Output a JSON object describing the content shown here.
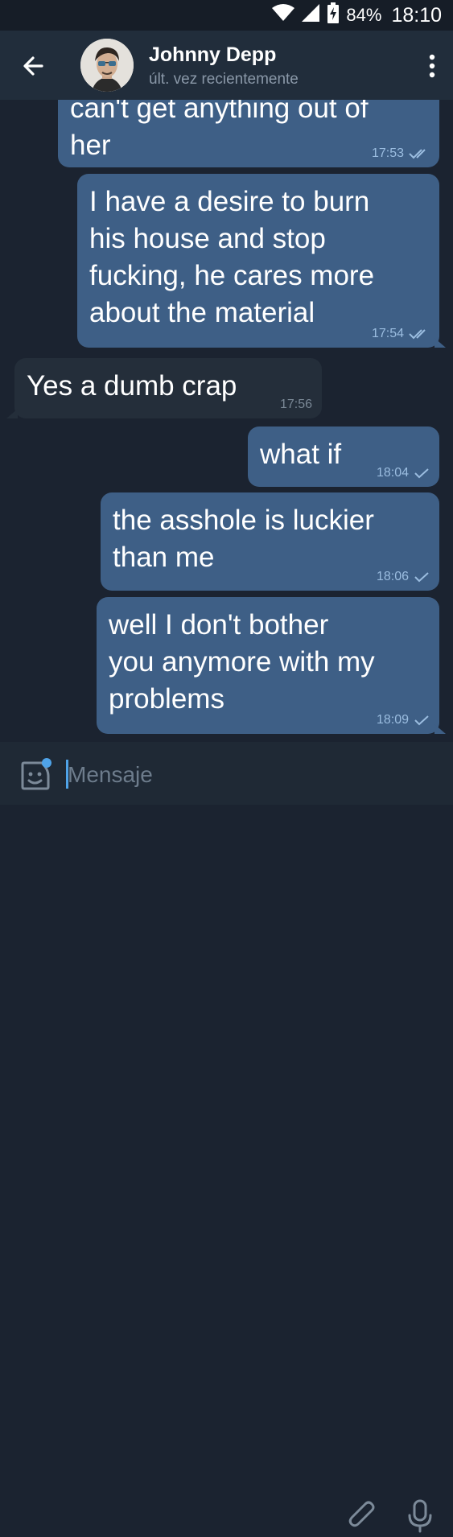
{
  "status_bar": {
    "battery": "84%",
    "time": "18:10"
  },
  "header": {
    "contact_name": "Johnny Depp",
    "contact_status": "últ. vez recientemente"
  },
  "messages": [
    {
      "direction": "out",
      "text": "can't get anything out of\nher",
      "time": "17:53",
      "status": "read"
    },
    {
      "direction": "out",
      "text": "I have a desire to burn\nhis house and stop\nfucking, he cares more\nabout the material",
      "time": "17:54",
      "status": "read"
    },
    {
      "direction": "in",
      "text": "Yes a dumb crap",
      "time": "17:56"
    },
    {
      "direction": "out",
      "text": "what if",
      "time": "18:04",
      "status": "sent"
    },
    {
      "direction": "out",
      "text": "the asshole is luckier\nthan me",
      "time": "18:06",
      "status": "sent"
    },
    {
      "direction": "out",
      "text": "well I don't bother\nyou anymore with my\nproblems",
      "time": "18:09",
      "status": "sent"
    }
  ],
  "input": {
    "placeholder": "Mensaje",
    "value": ""
  },
  "colors": {
    "background": "#1b2330",
    "header": "#212d3b",
    "outgoing_bubble": "#3e5f86",
    "incoming_bubble": "#242e3a",
    "accent": "#4fa3e8"
  }
}
